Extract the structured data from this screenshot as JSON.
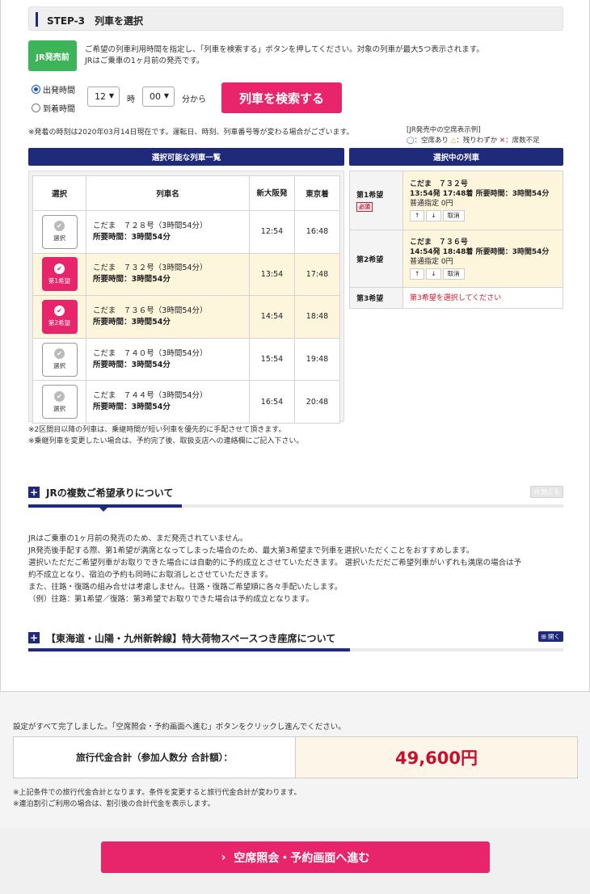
{
  "step": {
    "title": "STEP-3　列車を選択"
  },
  "jr_badge": "JR発売前",
  "intro": {
    "line1": "ご希望の列車利用時間を指定し、「列車を検索する」ボタンを押してください。対象の列車が最大5つ表示されます。",
    "line2": "JRはご乗車の1ヶ月前の発売です。"
  },
  "time_search": {
    "departure_label": "出発時間",
    "arrival_label": "到着時間",
    "hour_value": "12",
    "hour_unit": "時",
    "minute_value": "00",
    "from_label": "分から",
    "search_button": "列車を検索する"
  },
  "notice": "※発着の時刻は2020年03月14日現在です。運転日、時刻、列車番号等が変わる場合がございます。",
  "legend": {
    "title": "[JR発売中の空席表示例]",
    "circle": "◯",
    "available": "：空席あり",
    "triangle": "△",
    "few": "：残りわずか",
    "cross": "✕",
    "none": "：席数不足"
  },
  "available_list": {
    "header": "選択可能な列車一覧",
    "columns": [
      "選択",
      "列車名",
      "新大阪発",
      "東京着"
    ],
    "rows": [
      {
        "name": "こだま　７２８号（3時間54分）",
        "duration": "所要時間：3時間54分",
        "dep": "12:54",
        "arr": "16:48",
        "pick_label": "選択",
        "selected": false
      },
      {
        "name": "こだま　７３２号（3時間54分）",
        "duration": "所要時間：3時間54分",
        "dep": "13:54",
        "arr": "17:48",
        "pick_label": "第1希望",
        "selected": true
      },
      {
        "name": "こだま　７３６号（3時間54分）",
        "duration": "所要時間：3時間54分",
        "dep": "14:54",
        "arr": "18:48",
        "pick_label": "第2希望",
        "selected": true
      },
      {
        "name": "こだま　７４０号（3時間54分）",
        "duration": "所要時間：3時間54分",
        "dep": "15:54",
        "arr": "19:48",
        "pick_label": "選択",
        "selected": false
      },
      {
        "name": "こだま　７４４号（3時間54分）",
        "duration": "所要時間：3時間54分",
        "dep": "16:54",
        "arr": "20:48",
        "pick_label": "選択",
        "selected": false
      }
    ],
    "note1": "※2区間目以降の列車は、乗継時間が短い列車を優先的に手配させて頂きます。",
    "note2": "※乗継列車を変更したい場合は、予約完了後、取扱支店への連絡欄にご記入下さい。"
  },
  "chosen_list": {
    "header": "選択中の列車",
    "first": {
      "rank": "第1希望",
      "required": "必須",
      "train": "こだま　７３２号",
      "times": "13:54発 17:48着 所要時間：3時間54分",
      "seat": "普通指定 0円",
      "up": "↑",
      "down": "↓",
      "cancel": "取消"
    },
    "second": {
      "rank": "第2希望",
      "train": "こだま　７３６号",
      "times": "14:54発 18:48着 所要時間：3時間54分",
      "seat": "普通指定 0円",
      "up": "↑",
      "down": "↓",
      "cancel": "取消"
    },
    "third": {
      "rank": "第3希望",
      "message": "第3希望を選択してください"
    }
  },
  "multi_section": {
    "title": "JRの複数ご希望承りについて",
    "toggle": "閉じる",
    "lines": [
      "JRはご乗車の1ヶ月前の発売のため、まだ発売されていません。",
      "JR発売後手配する際、第1希望が満席となってしまった場合のため、最大第3希望まで列車を選択いただくことをおすすめします。",
      "選択いただだご希望列車がお取りできた場合には自動的に予約成立とさせていただきます。 選択いただだご希望列車がいずれも満席の場合は予",
      "約不成立となり、宿泊の予約も同時にお取消しとさせていただきます。",
      "また、往路・復路の組み合せは考慮しません。往路・復路ご希望順に各々手配いたします。",
      "（例）往路：第1希望／復路：第3希望でお取りできた場合は予約成立となります。"
    ]
  },
  "luggage_section": {
    "title": "【東海道・山陽・九州新幹線】特大荷物スペースつき座席について",
    "toggle": "開く"
  },
  "completion_note": "設定がすべて完了しました。「空席照会・予約画面へ進む」ボタンをクリックし進んでください。",
  "price": {
    "label": "旅行代金合計（参加人数分 合計額）：",
    "value": "49,600円"
  },
  "footer_notes": {
    "n1": "※上記条件での旅行代金合計となります。条件を変更すると旅行代金合計が変わります。",
    "n2": "※連泊割引ご利用の場合は、割引後の合計代金を表示します。"
  },
  "proceed_button": "空席照会・予約画面へ進む",
  "colors": {
    "navy": "#1f2a7a",
    "pink": "#e8256b",
    "green": "#3db35a",
    "price_red": "#c8102e",
    "selected_row": "#fdf5dc"
  }
}
